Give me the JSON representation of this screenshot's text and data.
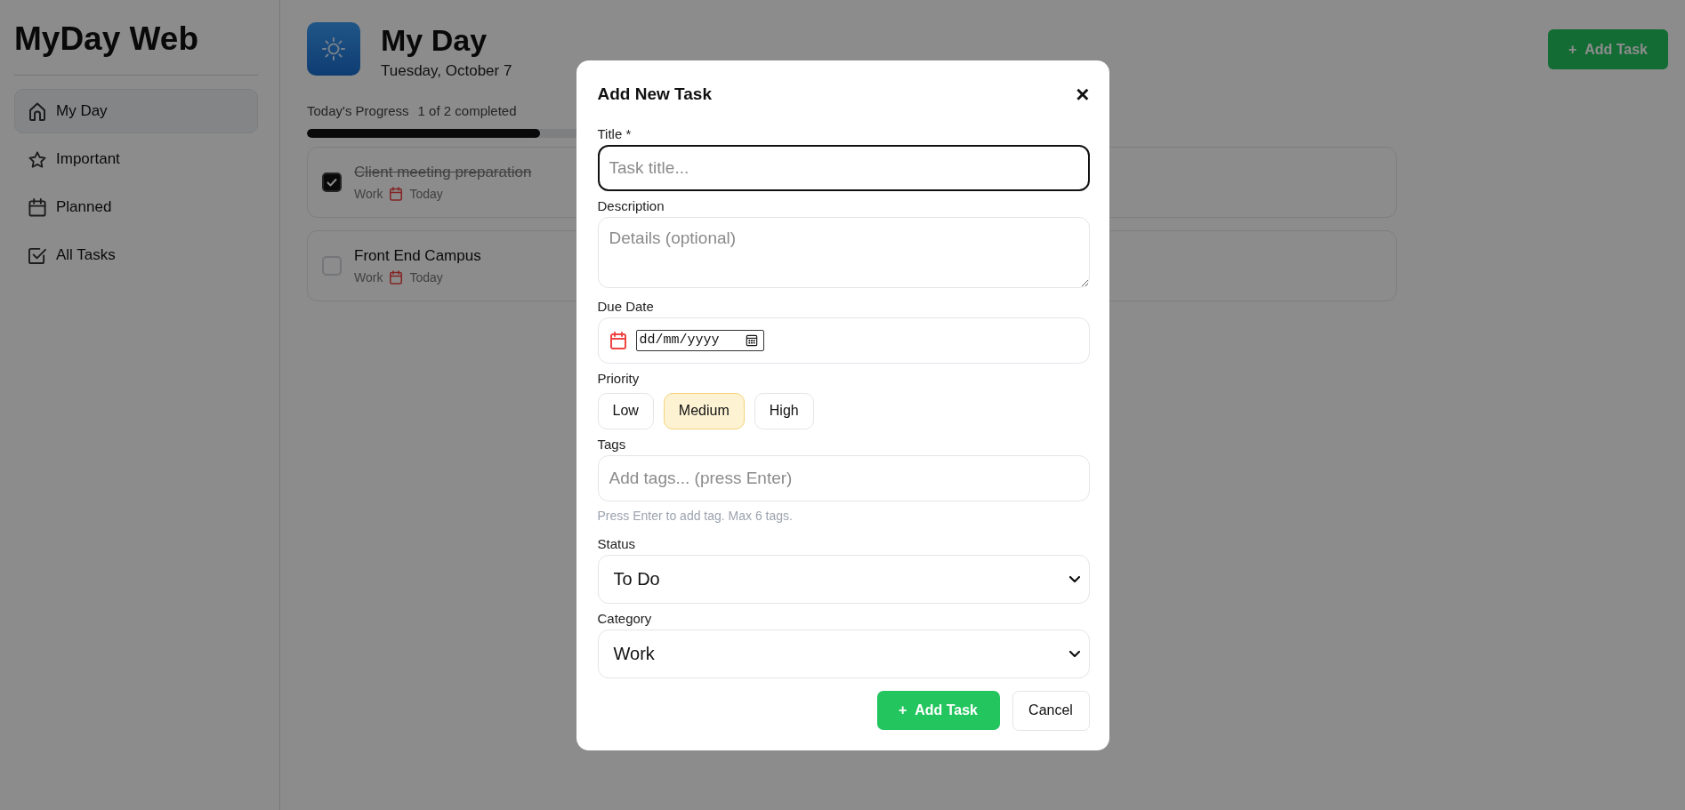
{
  "sidebar": {
    "title": "MyDay Web",
    "items": [
      {
        "label": "My Day",
        "selected": true
      },
      {
        "label": "Important",
        "selected": false
      },
      {
        "label": "Planned",
        "selected": false
      },
      {
        "label": "All Tasks",
        "selected": false
      }
    ]
  },
  "header": {
    "title": "My Day",
    "date": "Tuesday, October 7",
    "add_button": {
      "icon": "+",
      "label": "Add Task"
    }
  },
  "progress": {
    "label": "Today's Progress",
    "count": "1 of 2 completed",
    "level": 0.5
  },
  "tasks": [
    {
      "title": "Client meeting preparation",
      "done": true,
      "category": "Work",
      "due": "Today"
    },
    {
      "title": "Front End Campus",
      "done": false,
      "category": "Work",
      "due": "Today"
    }
  ],
  "dialog": {
    "title": "Add New Task",
    "close": "×",
    "fields": [
      {
        "kind": "text",
        "label": "Title *",
        "placeholder": "Task title...",
        "focused": true
      },
      {
        "kind": "textarea",
        "label": "Description",
        "placeholder": "Details (optional)"
      },
      {
        "kind": "date",
        "label": "Due Date",
        "placeholder": "dd/mm/yyyy"
      },
      {
        "kind": "choice",
        "label": "Priority",
        "options": [
          {
            "label": "Low",
            "selected": false
          },
          {
            "label": "Medium",
            "selected": true
          },
          {
            "label": "High",
            "selected": false
          }
        ]
      },
      {
        "kind": "tags",
        "label": "Tags",
        "placeholder": "Add tags... (press Enter)",
        "hint": "Press Enter to add tag. Max 6 tags."
      },
      {
        "kind": "select",
        "label": "Status",
        "value": "To Do"
      },
      {
        "kind": "select",
        "label": "Category",
        "value": "Work"
      }
    ],
    "actions": [
      {
        "icon": "+",
        "label": "Add Task",
        "primary": true
      },
      {
        "label": "Cancel",
        "primary": false
      }
    ]
  }
}
